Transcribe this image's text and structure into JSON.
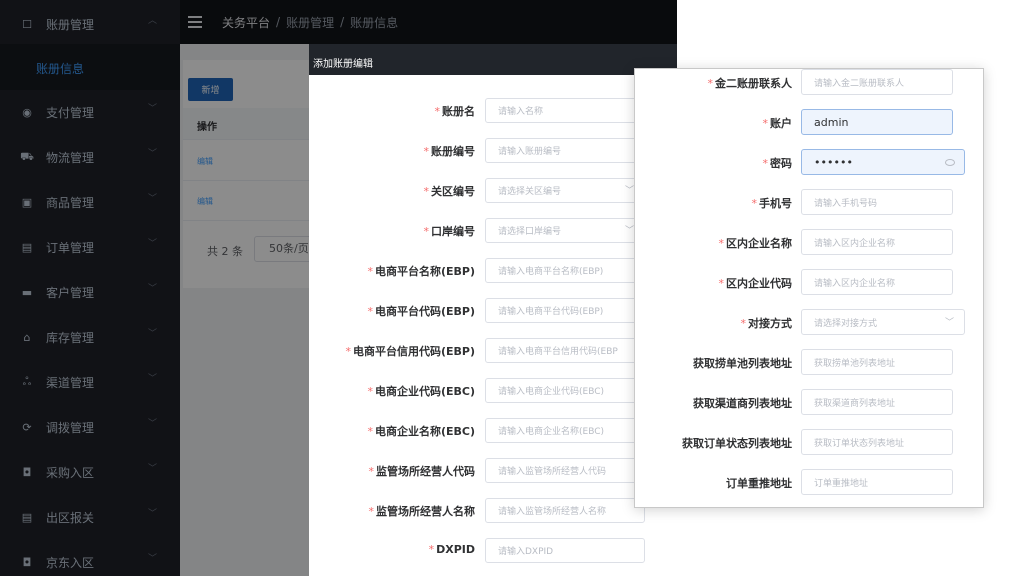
{
  "sidebar": {
    "items": [
      {
        "label": "账册管理",
        "icon": "ledger-icon",
        "glyph": "☐",
        "arrow": "︿"
      },
      {
        "label": "支付管理",
        "icon": "payment-icon",
        "glyph": "◉",
        "arrow": "﹀"
      },
      {
        "label": "物流管理",
        "icon": "truck-icon",
        "glyph": "⛟",
        "arrow": "﹀"
      },
      {
        "label": "商品管理",
        "icon": "goods-icon",
        "glyph": "▣",
        "arrow": "﹀"
      },
      {
        "label": "订单管理",
        "icon": "order-icon",
        "glyph": "▤",
        "arrow": "﹀"
      },
      {
        "label": "客户管理",
        "icon": "customer-icon",
        "glyph": "▬",
        "arrow": "﹀"
      },
      {
        "label": "库存管理",
        "icon": "warehouse-icon",
        "glyph": "⌂",
        "arrow": "﹀"
      },
      {
        "label": "渠道管理",
        "icon": "channel-icon",
        "glyph": "ஃ",
        "arrow": "﹀"
      },
      {
        "label": "调拨管理",
        "icon": "transfer-icon",
        "glyph": "⟳",
        "arrow": "﹀"
      },
      {
        "label": "采购入区",
        "icon": "purchase-icon",
        "glyph": "◘",
        "arrow": "﹀"
      },
      {
        "label": "出区报关",
        "icon": "customs-icon",
        "glyph": "▤",
        "arrow": "﹀"
      },
      {
        "label": "京东入区",
        "icon": "jd-icon",
        "glyph": "◘",
        "arrow": "﹀"
      }
    ],
    "submenu_active": "账册信息"
  },
  "topbar": {
    "crumb1": "关务平台",
    "sep": "/",
    "crumb2": "账册管理",
    "crumb3": "账册信息"
  },
  "page": {
    "new_button": "新增",
    "col_op": "操作",
    "edit1": "编辑",
    "edit2": "编辑",
    "total": "共 2 条",
    "page_size": "50条/页"
  },
  "modal": {
    "title": "添加账册编辑",
    "required_mark": "*",
    "fields": [
      {
        "label": "账册名",
        "placeholder": "请输入名称",
        "required": true
      },
      {
        "label": "账册编号",
        "placeholder": "请输入账册编号",
        "required": true
      },
      {
        "label": "关区编号",
        "placeholder": "请选择关区编号",
        "required": true
      },
      {
        "label": "口岸编号",
        "placeholder": "请选择口岸编号",
        "required": true
      },
      {
        "label": "电商平台名称(EBP)",
        "placeholder": "请输入电商平台名称(EBP)",
        "required": true
      },
      {
        "label": "电商平台代码(EBP)",
        "placeholder": "请输入电商平台代码(EBP)",
        "required": true
      },
      {
        "label": "电商平台信用代码(EBP)",
        "placeholder": "请输入电商平台信用代码(EBP",
        "required": true
      },
      {
        "label": "电商企业代码(EBC)",
        "placeholder": "请输入电商企业代码(EBC)",
        "required": true
      },
      {
        "label": "电商企业名称(EBC)",
        "placeholder": "请输入电商企业名称(EBC)",
        "required": true
      },
      {
        "label": "监管场所经营人代码",
        "placeholder": "请输入监管场所经营人代码",
        "required": true
      },
      {
        "label": "监管场所经营人名称",
        "placeholder": "请输入监管场所经营人名称",
        "required": true
      },
      {
        "label": "DXPID",
        "placeholder": "请输入DXPID",
        "required": true
      }
    ]
  },
  "panel": {
    "fields": [
      {
        "label": "金二账册联系人",
        "placeholder": "请输入金二账册联系人",
        "required": true
      },
      {
        "label": "账户",
        "value": "admin",
        "required": true
      },
      {
        "label": "密码",
        "value": "••••••",
        "required": true
      },
      {
        "label": "手机号",
        "placeholder": "请输入手机号码",
        "required": true
      },
      {
        "label": "区内企业名称",
        "placeholder": "请输入区内企业名称",
        "required": true
      },
      {
        "label": "区内企业代码",
        "placeholder": "请输入区内企业名称",
        "required": true
      },
      {
        "label": "对接方式",
        "placeholder": "请选择对接方式",
        "required": true
      },
      {
        "label": "获取捞单池列表地址",
        "placeholder": "获取捞单池列表地址",
        "required": false
      },
      {
        "label": "获取渠道商列表地址",
        "placeholder": "获取渠道商列表地址",
        "required": false
      },
      {
        "label": "获取订单状态列表地址",
        "placeholder": "获取订单状态列表地址",
        "required": false
      },
      {
        "label": "订单重推地址",
        "placeholder": "订单重推地址",
        "required": false
      }
    ],
    "select_arrow": "﹀"
  },
  "colors": {
    "sidebar_bg": "#1f2229",
    "active_text": "#409eff",
    "required": "#f56c6c",
    "primary_button": "#1f64b8"
  }
}
